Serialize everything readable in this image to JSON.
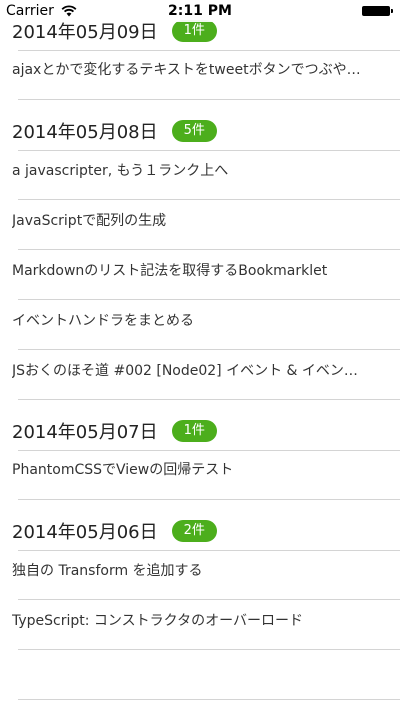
{
  "status_bar": {
    "carrier": "Carrier",
    "time": "2:11 PM"
  },
  "sections": [
    {
      "date": "2014年05月09日",
      "count": "1件",
      "items": [
        "ajaxとかで変化するテキストをtweetボタンでつぶや…"
      ]
    },
    {
      "date": "2014年05月08日",
      "count": "5件",
      "items": [
        "a javascripter, もう１ランク上へ",
        "JavaScriptで配列の生成",
        "Markdownのリスト記法を取得するBookmarklet",
        "イベントハンドラをまとめる",
        "JSおくのほそ道 #002 [Node02] イベント & イベン…"
      ]
    },
    {
      "date": "2014年05月07日",
      "count": "1件",
      "items": [
        "PhantomCSSでViewの回帰テスト"
      ]
    },
    {
      "date": "2014年05月06日",
      "count": "2件",
      "items": [
        "独自の Transform を追加する",
        "TypeScript: コンストラクタのオーバーロード"
      ]
    }
  ],
  "colors": {
    "badge": "#4cae1c",
    "separator": "#d4d4d4"
  }
}
